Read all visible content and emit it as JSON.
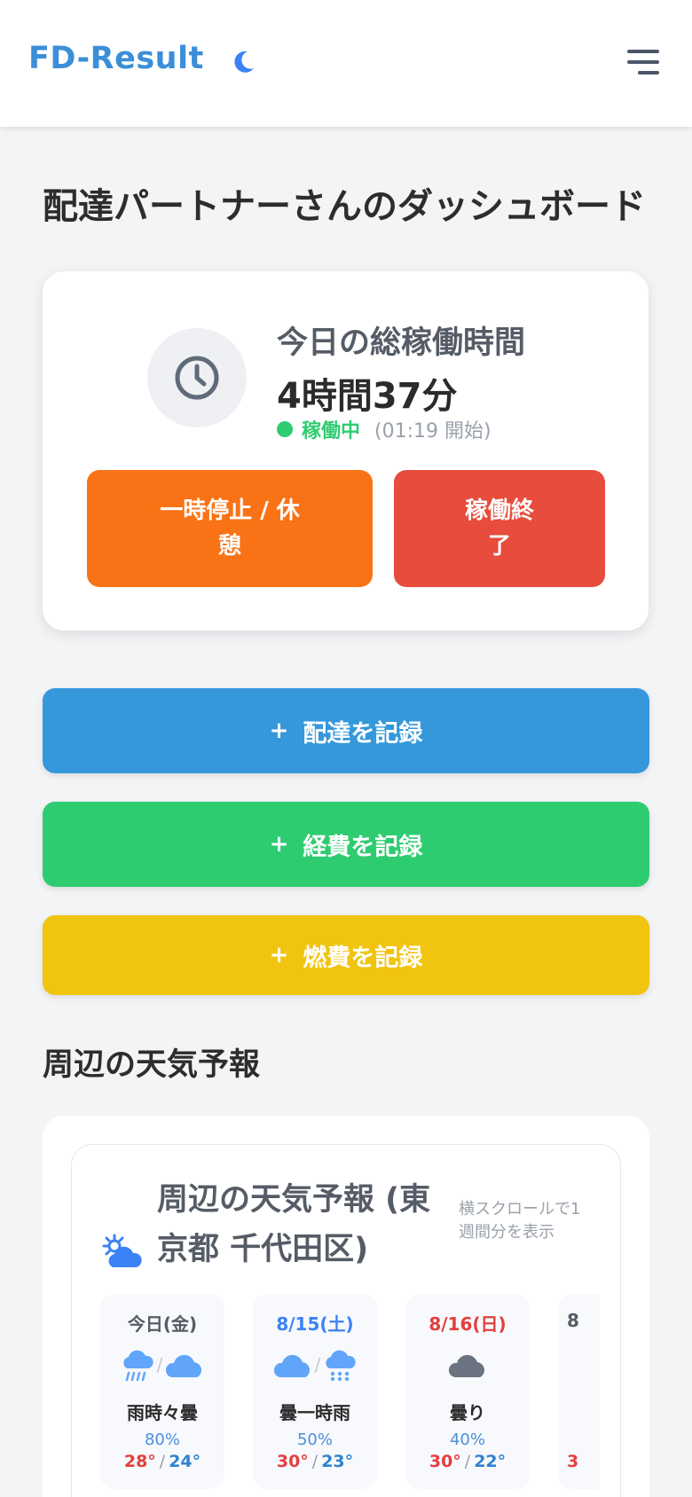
{
  "header": {
    "logo": "FD-Result",
    "theme_toggle_icon": "moon-icon",
    "menu_icon": "hamburger-menu-icon"
  },
  "page_title": "配達パートナーさんのダッシュボード",
  "work_status": {
    "label": "今日の総稼働時間",
    "total_time": "4時間37分",
    "status": "稼働中",
    "start_note": "(01:19 開始)",
    "status_color": "#2ecc71",
    "pause_button": "一時停止 / 休憩",
    "end_button": "稼働終了"
  },
  "actions": [
    {
      "label": "配達を記録",
      "color": "#3498db"
    },
    {
      "label": "経費を記録",
      "color": "#2ecc71"
    },
    {
      "label": "燃費を記録",
      "color": "#f1c40f"
    }
  ],
  "weather": {
    "section_title": "周辺の天気予報",
    "card_title": "周辺の天気予報 (東京都 千代田区)",
    "scroll_hint": "横スクロールで1週間分を表示",
    "days": [
      {
        "label": "今日(金)",
        "label_color": "#555c66",
        "icons": [
          "rain-icon",
          "cloud-icon"
        ],
        "condition": "雨時々曇",
        "precip": "80%",
        "high": "28°",
        "low": "24°"
      },
      {
        "label": "8/15(土)",
        "label_color": "#3b82f6",
        "icons": [
          "cloud-icon",
          "rain-icon"
        ],
        "condition": "曇一時雨",
        "precip": "50%",
        "high": "30°",
        "low": "23°"
      },
      {
        "label": "8/16(日)",
        "label_color": "#e53e3e",
        "icons": [
          "cloud-dark-icon"
        ],
        "condition": "曇り",
        "precip": "40%",
        "high": "30°",
        "low": "22°"
      },
      {
        "label": "8",
        "label_color": "#555c66",
        "icons": [],
        "condition": "",
        "precip": "",
        "high": "3",
        "low": ""
      }
    ]
  }
}
